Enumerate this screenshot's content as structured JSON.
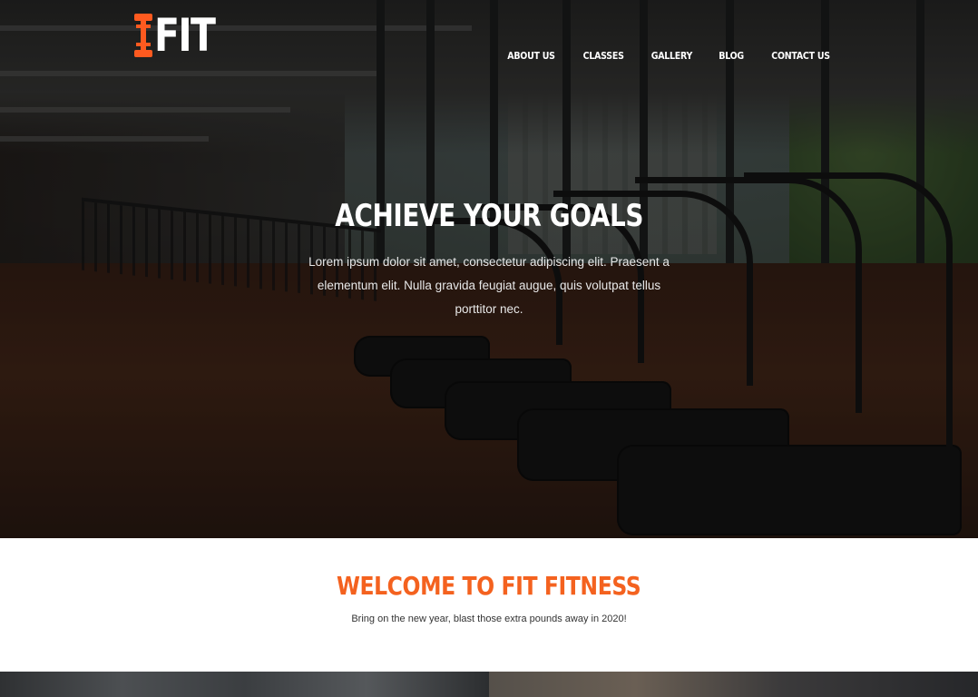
{
  "logo": {
    "text": "FIT",
    "icon": "dumbbell-icon",
    "icon_color": "#ff5a1f"
  },
  "nav": {
    "items": [
      {
        "label": "ABOUT US"
      },
      {
        "label": "CLASSES"
      },
      {
        "label": "GALLERY"
      },
      {
        "label": "BLOG"
      },
      {
        "label": "CONTACT US"
      }
    ]
  },
  "hero": {
    "title": "ACHIEVE YOUR GOALS",
    "text": "Lorem ipsum dolor sit amet, consectetur adipiscing elit. Praesent a elementum elit. Nulla gravida feugiat augue, quis volutpat tellus porttitor nec."
  },
  "welcome": {
    "title": "WELCOME TO FIT FITNESS",
    "text": "Bring on the new year, blast those extra pounds away in 2020!",
    "accent_color": "#f4621f"
  }
}
